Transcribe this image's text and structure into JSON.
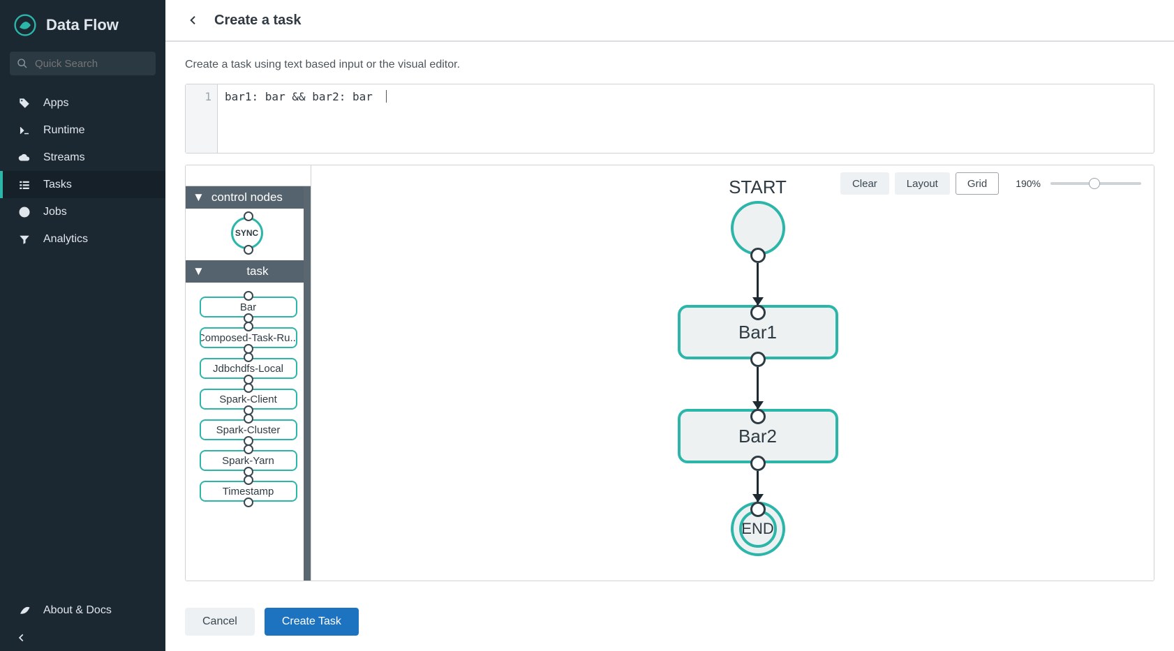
{
  "brand": {
    "name": "Data Flow"
  },
  "search": {
    "placeholder": "Quick Search"
  },
  "nav": {
    "items": [
      {
        "id": "apps",
        "label": "Apps",
        "icon": "tag-icon"
      },
      {
        "id": "runtime",
        "label": "Runtime",
        "icon": "terminal-icon"
      },
      {
        "id": "streams",
        "label": "Streams",
        "icon": "cloud-icon"
      },
      {
        "id": "tasks",
        "label": "Tasks",
        "icon": "list-icon"
      },
      {
        "id": "jobs",
        "label": "Jobs",
        "icon": "clock-icon"
      },
      {
        "id": "analytics",
        "label": "Analytics",
        "icon": "filter-icon"
      }
    ],
    "active": "tasks",
    "about_label": "About & Docs"
  },
  "header": {
    "title": "Create a task"
  },
  "intro": "Create a task using text based input or the visual editor.",
  "editor": {
    "line_number": "1",
    "content": "bar1: bar && bar2: bar"
  },
  "palette": {
    "groups": [
      {
        "id": "control",
        "label": "control nodes",
        "sync_label": "SYNC"
      },
      {
        "id": "task",
        "label": "task",
        "items": [
          "Bar",
          "Composed-Task-Ru...",
          "Jdbchdfs-Local",
          "Spark-Client",
          "Spark-Cluster",
          "Spark-Yarn",
          "Timestamp"
        ]
      }
    ]
  },
  "canvas": {
    "toolbar": {
      "clear": "Clear",
      "layout": "Layout",
      "grid": "Grid",
      "zoom_label": "190%",
      "active": "grid"
    },
    "flow": {
      "start_label": "START",
      "end_label": "END",
      "nodes": [
        "Bar1",
        "Bar2"
      ]
    }
  },
  "footer": {
    "cancel": "Cancel",
    "create": "Create Task"
  }
}
